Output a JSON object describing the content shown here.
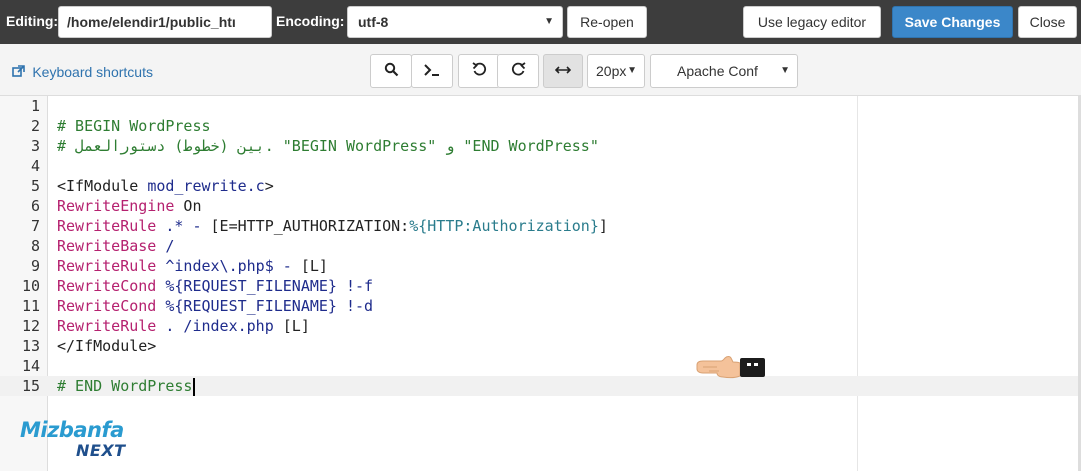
{
  "toolbar": {
    "editing_label": "Editing:",
    "file_path": "/home/elendir1/public_htı",
    "encoding_label": "Encoding:",
    "encoding_value": "utf-8",
    "reopen_label": "Re-open",
    "legacy_label": "Use legacy editor",
    "save_label": "Save Changes",
    "close_label": "Close"
  },
  "subtoolbar": {
    "keyboard_shortcuts": "Keyboard shortcuts",
    "font_size": "20px",
    "mode": "Apache Conf"
  },
  "editor": {
    "active_line": 15,
    "lines": [
      {
        "num": "1",
        "tokens": []
      },
      {
        "num": "2",
        "tokens": [
          {
            "c": "cm",
            "t": "# BEGIN WordPress"
          }
        ]
      },
      {
        "num": "3",
        "tokens": [
          {
            "c": "cm",
            "t": "# بين (خطوط) دستورالعمل. \"BEGIN WordPress\" و \"END WordPress\""
          }
        ]
      },
      {
        "num": "4",
        "tokens": []
      },
      {
        "num": "5",
        "tokens": [
          {
            "c": "",
            "t": "<IfModule "
          },
          {
            "c": "strcode",
            "t": "mod_rewrite.c"
          },
          {
            "c": "",
            "t": ">"
          }
        ]
      },
      {
        "num": "6",
        "tokens": [
          {
            "c": "kw",
            "t": "RewriteEngine"
          },
          {
            "c": "",
            "t": " On"
          }
        ]
      },
      {
        "num": "7",
        "tokens": [
          {
            "c": "kw",
            "t": "RewriteRule"
          },
          {
            "c": "strcode",
            "t": " .* - "
          },
          {
            "c": "",
            "t": "[E=HTTP_AUTHORIZATION:"
          },
          {
            "c": "var",
            "t": "%{HTTP:Authorization}"
          },
          {
            "c": "",
            "t": "]"
          }
        ]
      },
      {
        "num": "8",
        "tokens": [
          {
            "c": "kw",
            "t": "RewriteBase"
          },
          {
            "c": "strcode",
            "t": " /"
          }
        ]
      },
      {
        "num": "9",
        "tokens": [
          {
            "c": "kw",
            "t": "RewriteRule"
          },
          {
            "c": "strcode",
            "t": " ^index\\.php$ - "
          },
          {
            "c": "",
            "t": "[L]"
          }
        ]
      },
      {
        "num": "10",
        "tokens": [
          {
            "c": "kw",
            "t": "RewriteCond"
          },
          {
            "c": "strcode",
            "t": " %{REQUEST_FILENAME} !-f"
          }
        ]
      },
      {
        "num": "11",
        "tokens": [
          {
            "c": "kw",
            "t": "RewriteCond"
          },
          {
            "c": "strcode",
            "t": " %{REQUEST_FILENAME} !-d"
          }
        ]
      },
      {
        "num": "12",
        "tokens": [
          {
            "c": "kw",
            "t": "RewriteRule"
          },
          {
            "c": "strcode",
            "t": " . /index.php "
          },
          {
            "c": "",
            "t": "[L]"
          }
        ]
      },
      {
        "num": "13",
        "tokens": [
          {
            "c": "",
            "t": "</IfModule>"
          }
        ]
      },
      {
        "num": "14",
        "tokens": []
      },
      {
        "num": "15",
        "tokens": [
          {
            "c": "cm",
            "t": "# END WordPress"
          }
        ]
      }
    ]
  },
  "logo": {
    "line1": "Mizbanfa",
    "line2": "NEXT"
  },
  "colors": {
    "topbar": "#3d3d3d",
    "primary": "#3b87c9",
    "link": "#2f73ae",
    "comment": "#2e7d32",
    "keyword": "#b5216f"
  }
}
